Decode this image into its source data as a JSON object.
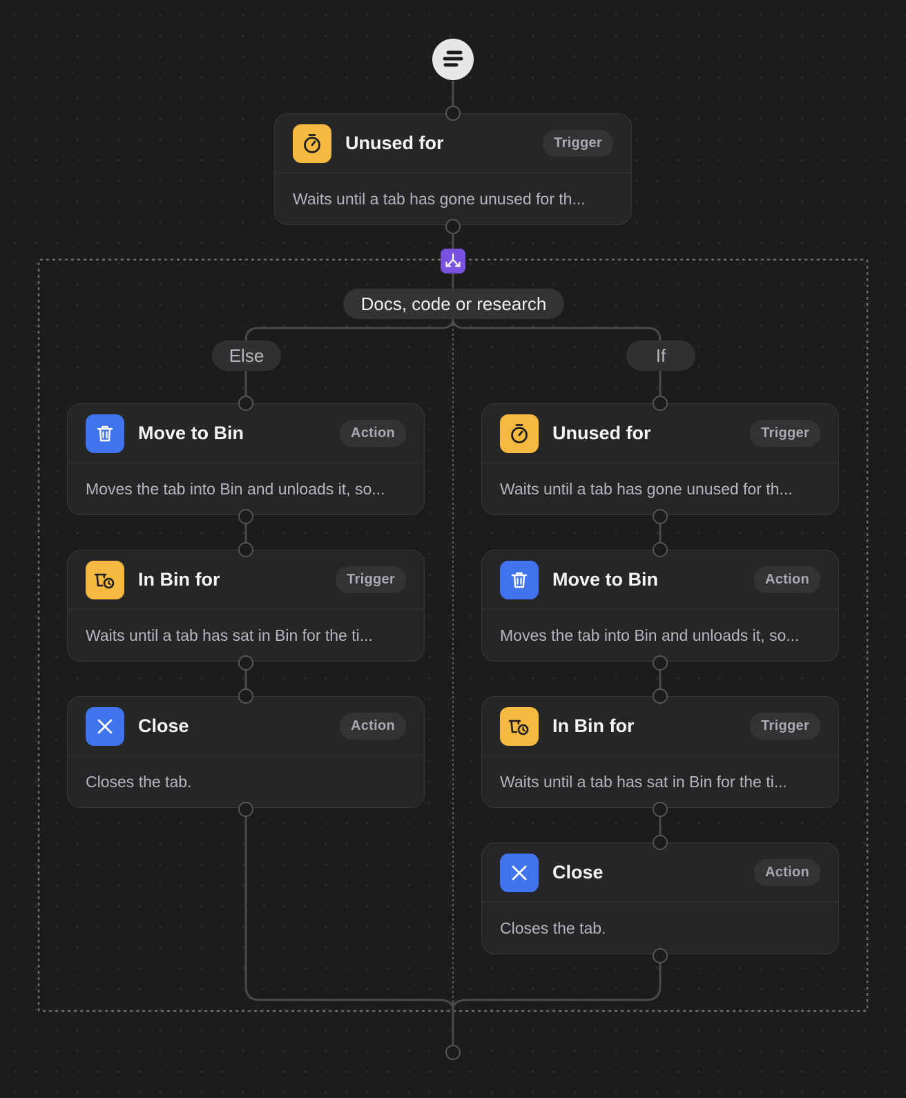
{
  "condition": {
    "label": "Docs, code or research"
  },
  "branches": {
    "else_label": "Else",
    "if_label": "If"
  },
  "nodes": {
    "root": {
      "title": "Unused for",
      "badge": "Trigger",
      "description": "Waits until a tab has gone unused for th...",
      "icon": "timer-icon"
    },
    "else_1": {
      "title": "Move to Bin",
      "badge": "Action",
      "description": "Moves the tab into Bin and unloads it, so...",
      "icon": "trash-icon"
    },
    "else_2": {
      "title": "In Bin for",
      "badge": "Trigger",
      "description": "Waits until a tab has sat in Bin for the ti...",
      "icon": "bin-timer-icon"
    },
    "else_3": {
      "title": "Close",
      "badge": "Action",
      "description": "Closes the tab.",
      "icon": "close-icon"
    },
    "if_1": {
      "title": "Unused for",
      "badge": "Trigger",
      "description": "Waits until a tab has gone unused for th...",
      "icon": "timer-icon"
    },
    "if_2": {
      "title": "Move to Bin",
      "badge": "Action",
      "description": "Moves the tab into Bin and unloads it, so...",
      "icon": "trash-icon"
    },
    "if_3": {
      "title": "In Bin for",
      "badge": "Trigger",
      "description": "Waits until a tab has sat in Bin for the ti...",
      "icon": "bin-timer-icon"
    },
    "if_4": {
      "title": "Close",
      "badge": "Action",
      "description": "Closes the tab.",
      "icon": "close-icon"
    }
  },
  "colors": {
    "background": "#1c1c1d",
    "card": "#262628",
    "trigger_icon": "#f4b93e",
    "action_icon": "#3f74ec",
    "split_icon": "#7952e0"
  }
}
